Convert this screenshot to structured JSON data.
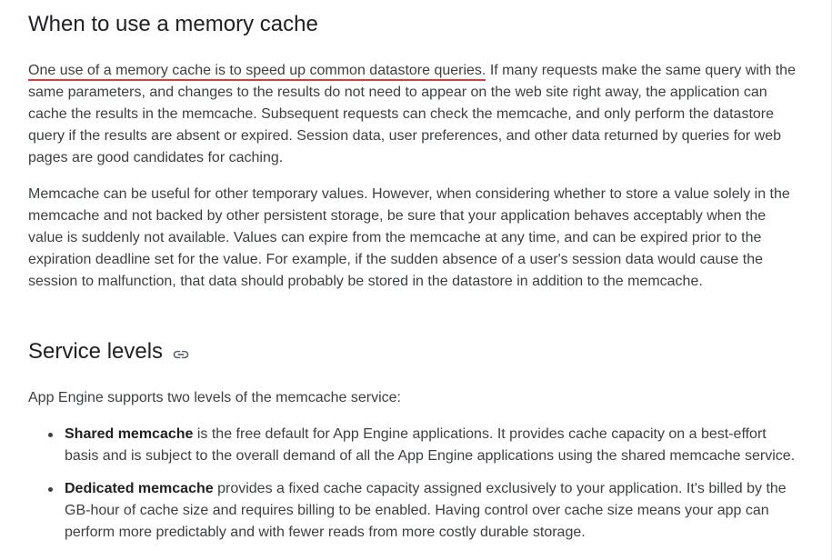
{
  "section1": {
    "heading": "When to use a memory cache",
    "para1_highlight": "One use of a memory cache is to speed up common datastore queries.",
    "para1_rest": " If many requests make the same query with the same parameters, and changes to the results do not need to appear on the web site right away, the application can cache the results in the memcache. Subsequent requests can check the memcache, and only perform the datastore query if the results are absent or expired. Session data, user preferences, and other data returned by queries for web pages are good candidates for caching.",
    "para2": "Memcache can be useful for other temporary values. However, when considering whether to store a value solely in the memcache and not backed by other persistent storage, be sure that your application behaves acceptably when the value is suddenly not available. Values can expire from the memcache at any time, and can be expired prior to the expiration deadline set for the value. For example, if the sudden absence of a user's session data would cause the session to malfunction, that data should probably be stored in the datastore in addition to the memcache."
  },
  "section2": {
    "heading": "Service levels",
    "link_icon": "link-icon",
    "intro": "App Engine supports two levels of the memcache service:",
    "items": [
      {
        "term": "Shared memcache",
        "text": " is the free default for App Engine applications. It provides cache capacity on a best-effort basis and is subject to the overall demand of all the App Engine applications using the shared memcache service."
      },
      {
        "term": "Dedicated memcache",
        "text": " provides a fixed cache capacity assigned exclusively to your application. It's billed by the GB-hour of cache size and requires billing to be enabled. Having control over cache size means your app can perform more predictably and with fewer reads from more costly durable storage."
      }
    ]
  },
  "colors": {
    "heading": "#202124",
    "body_text": "#3c4043",
    "highlight_underline": "#e53935",
    "icon": "#5f6368"
  }
}
